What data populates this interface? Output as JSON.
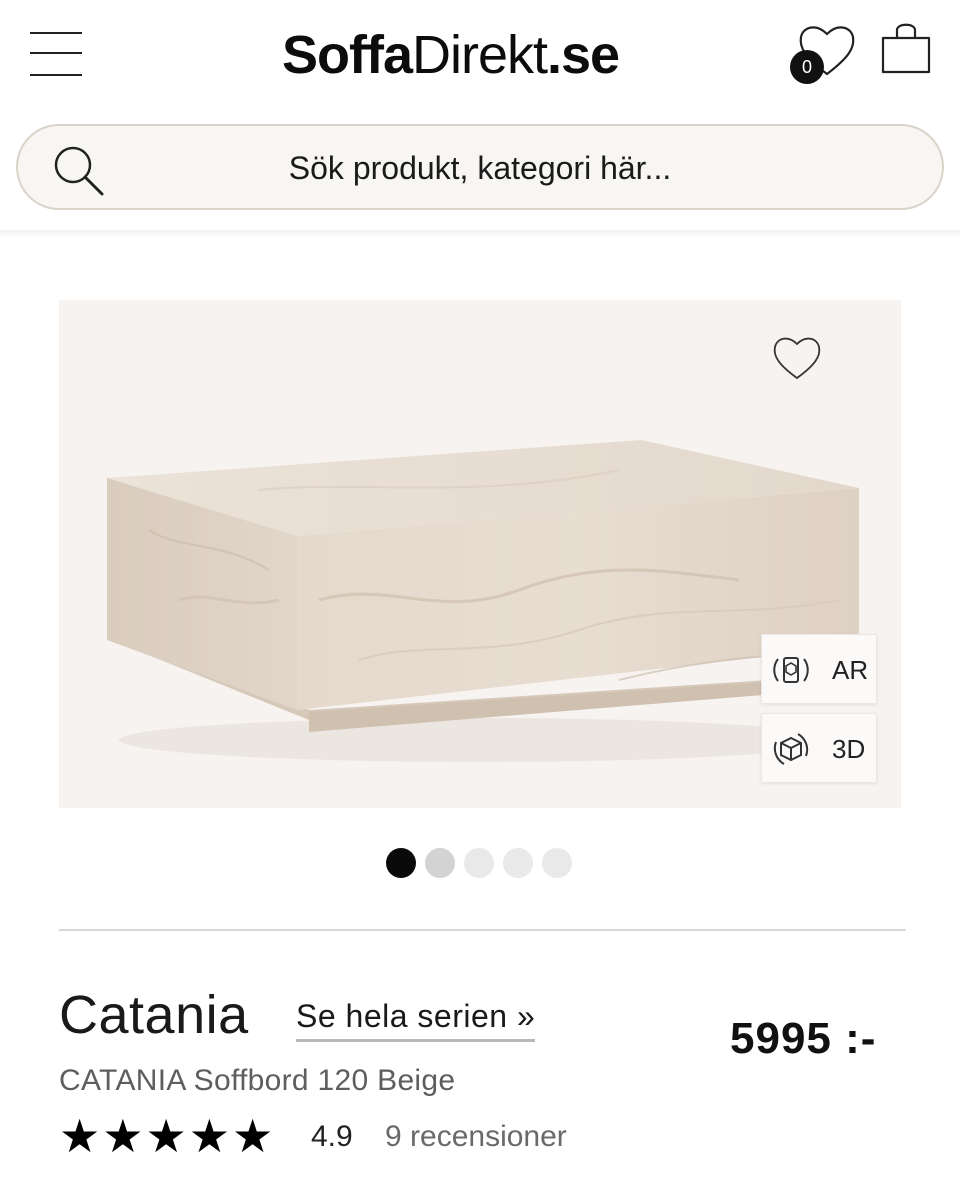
{
  "header": {
    "logo_bold": "Soffa",
    "logo_light": "Direkt",
    "logo_tld": ".se",
    "wishlist_count": "0",
    "search_placeholder": "Sök produkt, kategori här..."
  },
  "gallery": {
    "ar_label": "AR",
    "view3d_label": "3D",
    "slide_count": 5,
    "active_slide": 1,
    "colors": {
      "active_dot": "#0a0a0a",
      "second_dot": "#d3d3d3",
      "inactive_dot": "#e9e9e9"
    }
  },
  "product": {
    "name": "Catania",
    "series_link": "Se hela serien »",
    "price": "5995 :-",
    "subtitle": "CATANIA Soffbord 120 Beige",
    "stars": "★★★★★",
    "rating": "4.9",
    "reviews": "9 recensioner"
  },
  "icons": [
    "menu-icon",
    "heart-icon",
    "shopping-bag-icon",
    "search-icon",
    "ar-icon",
    "cube-3d-icon"
  ]
}
